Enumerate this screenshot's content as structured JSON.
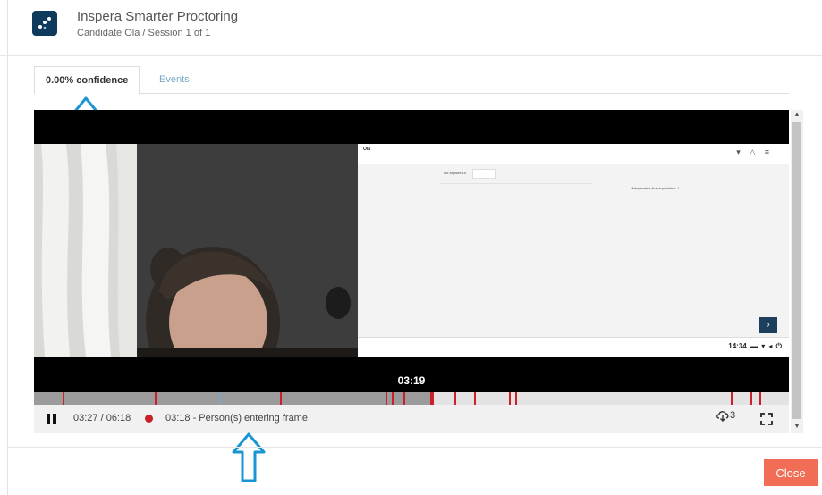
{
  "header": {
    "app_title": "Inspera Smarter Proctoring",
    "subtitle": "Candidate Ola / Session 1 of 1",
    "logo_icon": "inspera-logo-icon",
    "brand_color": "#0e3a5c"
  },
  "tabs": [
    {
      "label": "0.00% confidence",
      "active": true
    },
    {
      "label": "Events",
      "active": false
    }
  ],
  "annotations": {
    "arrow_color": "#1a95d3",
    "arrow_icon": "arrow-up-icon"
  },
  "screen_share": {
    "candidate_name": "Ola",
    "question_label": "Ou explore 10",
    "right_label": "Maksymalna liczba punktów: 1",
    "clock": "14:34",
    "next_icon": "chevron-right-icon",
    "status_icons": [
      "wifi-icon",
      "bell-icon",
      "menu-icon"
    ]
  },
  "player": {
    "current_time_overlay": "03:19",
    "time_display": "03:27 / 06:18",
    "event_text": "03:18 - Person(s) entering frame",
    "event_count": "3",
    "progress_fraction": 0.53,
    "event_color": "#c82127",
    "pause_icon": "pause-icon",
    "event_count_icon": "cloud-download-icon",
    "fullscreen_icon": "fullscreen-icon"
  },
  "footer": {
    "close_label": "Close",
    "close_color": "#f26d55"
  }
}
